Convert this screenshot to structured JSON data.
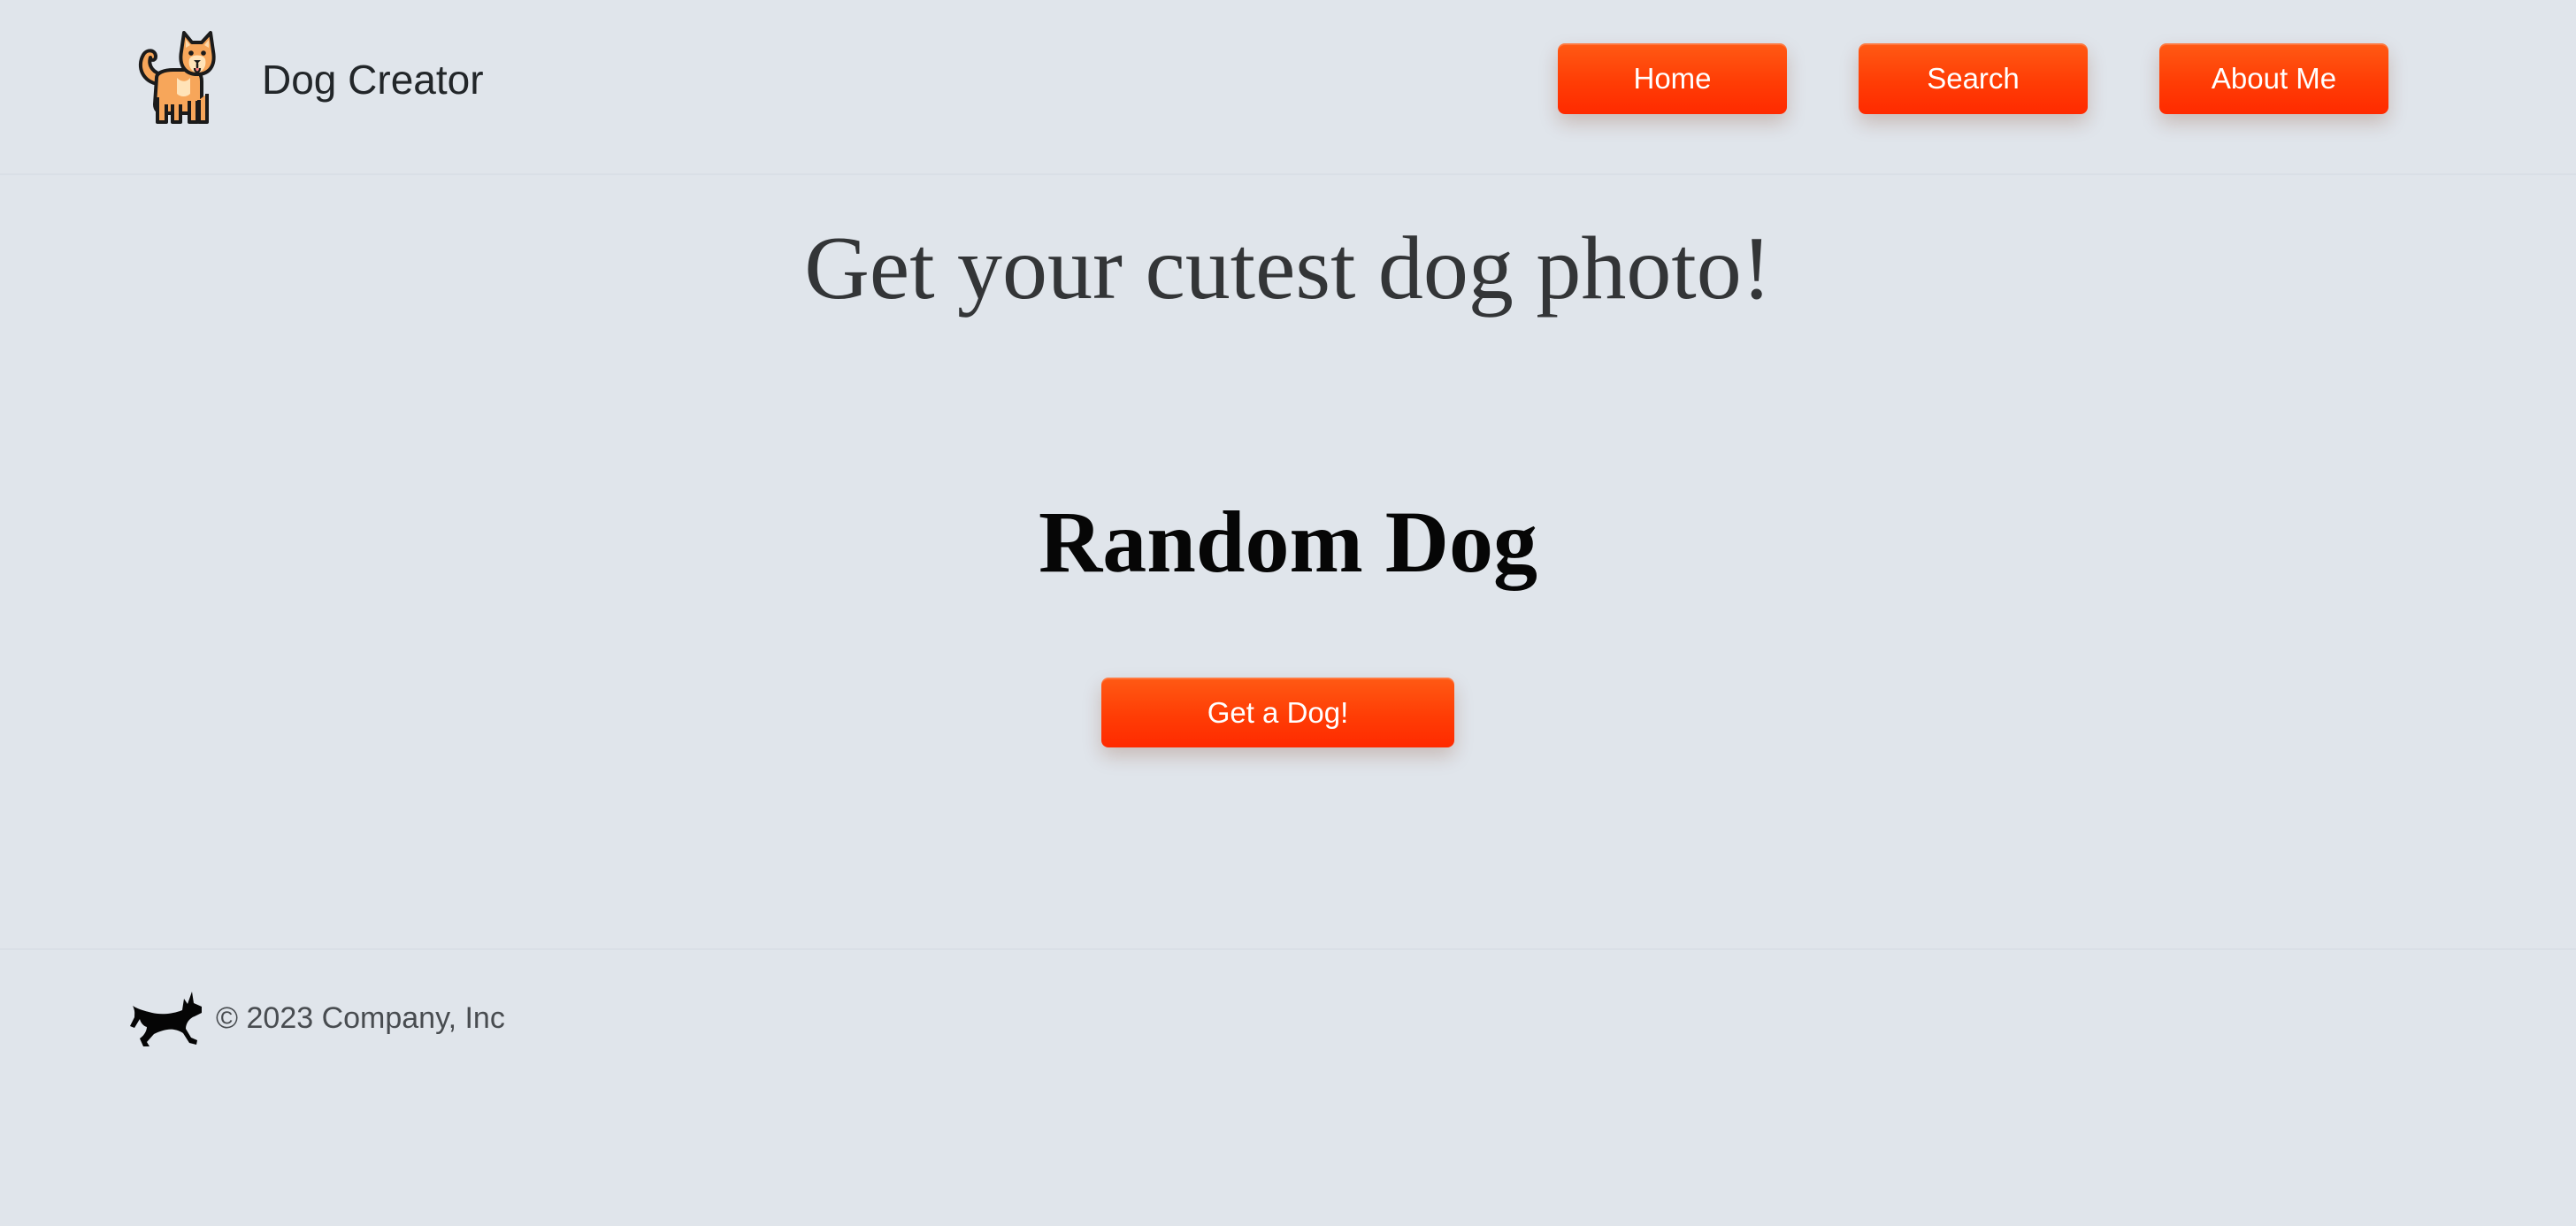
{
  "header": {
    "brand": "Dog Creator",
    "logo_icon": "dog-logo-icon",
    "nav": [
      {
        "label": "Home"
      },
      {
        "label": "Search"
      },
      {
        "label": "About Me"
      }
    ]
  },
  "main": {
    "hero_title": "Get your cutest dog photo!",
    "section_title": "Random Dog",
    "action_button": "Get a Dog!"
  },
  "footer": {
    "icon": "running-dog-silhouette-icon",
    "text": "© 2023 Company, Inc"
  },
  "colors": {
    "background": "#e0e5eb",
    "accent": "#ff3d05",
    "button_text": "#ffffff",
    "hero_text": "#333537",
    "section_text": "#060606"
  }
}
